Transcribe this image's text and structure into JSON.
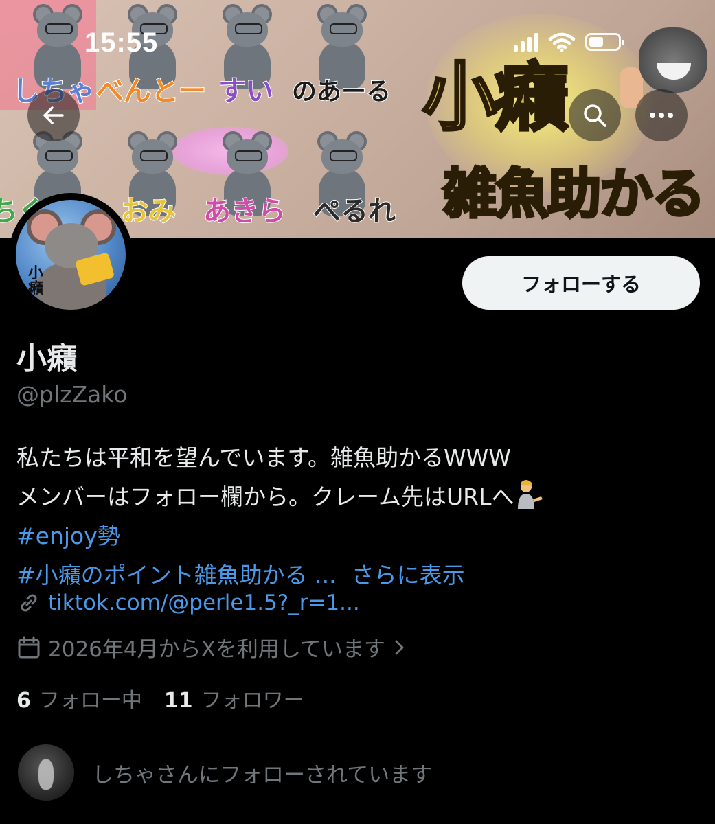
{
  "status_bar": {
    "time": "15:55"
  },
  "banner": {
    "member_tags": [
      "しちゃ",
      "べんとー",
      "すい",
      "のあーる",
      "ちく",
      "おみ",
      "あきら",
      "ぺるれ"
    ],
    "title": "小癪",
    "subtitle": "雑魚助かる"
  },
  "profile": {
    "display_name": "小癪",
    "handle": "@plzZako",
    "follow_button": "フォローする",
    "bio_lines": [
      "私たちは平和を望んでいます。雑魚助かるWWW",
      "メンバーはフォロー欄から。クレーム先はURLへ"
    ],
    "hashtag_1": "#enjoy勢",
    "hashtag_2": "#小癪のポイント雑魚助かる ...",
    "show_more": "さらに表示",
    "link": "tiktok.com/@perle1.5?_r=1...",
    "joined": "2026年4月からXを利用しています",
    "following_count": "6",
    "following_label": "フォロー中",
    "followers_count": "11",
    "followers_label": "フォロワー",
    "followed_by": "しちゃさんにフォローされています"
  },
  "icons": [
    "back-arrow-icon",
    "search-icon",
    "more-icon",
    "link-icon",
    "calendar-icon",
    "chevron-right-icon"
  ],
  "colors": {
    "link": "#4a99e9",
    "muted": "#71767b",
    "text": "#e7e9ea",
    "button_bg": "#eff3f4"
  }
}
